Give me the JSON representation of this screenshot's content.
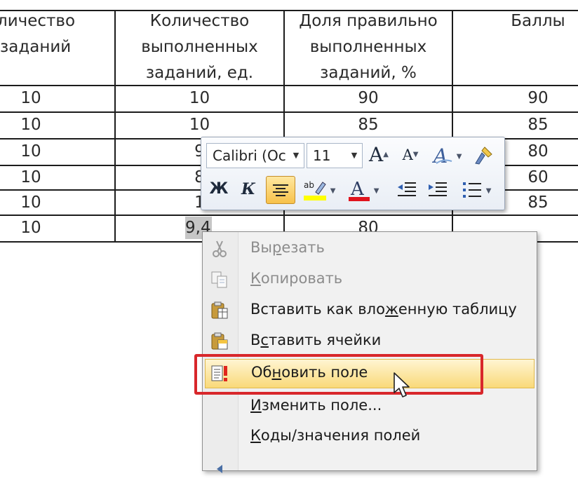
{
  "table": {
    "headers": [
      [
        "личество",
        "заданий"
      ],
      [
        "Количество",
        "выполненных",
        "заданий, ед."
      ],
      [
        "Доля правильно",
        "выполненных",
        "заданий, %"
      ],
      [
        "Баллы"
      ]
    ],
    "rows": [
      [
        "10",
        "10",
        "90",
        "90"
      ],
      [
        "10",
        "10",
        "85",
        "85"
      ],
      [
        "10",
        "9",
        "",
        "80"
      ],
      [
        "10",
        "8",
        "",
        "60"
      ],
      [
        "10",
        "1",
        "",
        "85"
      ],
      [
        "10",
        "9,4",
        "80",
        ""
      ]
    ]
  },
  "mini_toolbar": {
    "font_name": "Calibri (Ос",
    "font_size": "11",
    "bold_label": "Ж",
    "italic_label": "К",
    "grow_font_label": "A",
    "shrink_font_label": "A",
    "highlight_color": "#ffff00",
    "font_color": "#e0141e",
    "icons": [
      "grow-font-icon",
      "shrink-font-icon",
      "styles-icon",
      "format-painter-icon",
      "center-align-icon",
      "highlight-icon",
      "font-color-icon",
      "decrease-indent-icon",
      "increase-indent-icon",
      "bullets-icon"
    ]
  },
  "context_menu": {
    "items": [
      {
        "pre": "Вы",
        "hot": "р",
        "post": "езать",
        "enabled": false,
        "icon": "scissors-icon"
      },
      {
        "pre": "",
        "hot": "К",
        "post": "опировать",
        "enabled": false,
        "icon": "copy-icon"
      },
      {
        "pre": "Вставить как вло",
        "hot": "ж",
        "post": "енную таблицу",
        "enabled": true,
        "icon": "paste-icon"
      },
      {
        "pre": "В",
        "hot": "с",
        "post": "тавить ячейки",
        "enabled": true,
        "icon": "paste-cells-icon"
      },
      {
        "pre": "Об",
        "hot": "н",
        "post": "овить поле",
        "enabled": true,
        "icon": "update-field-icon"
      },
      {
        "pre": "",
        "hot": "И",
        "post": "зменить поле...",
        "enabled": true,
        "icon": ""
      },
      {
        "pre": "",
        "hot": "К",
        "post": "оды/значения полей",
        "enabled": true,
        "icon": ""
      }
    ],
    "highlighted_index": 4,
    "highlight_color": "#d8272b"
  }
}
